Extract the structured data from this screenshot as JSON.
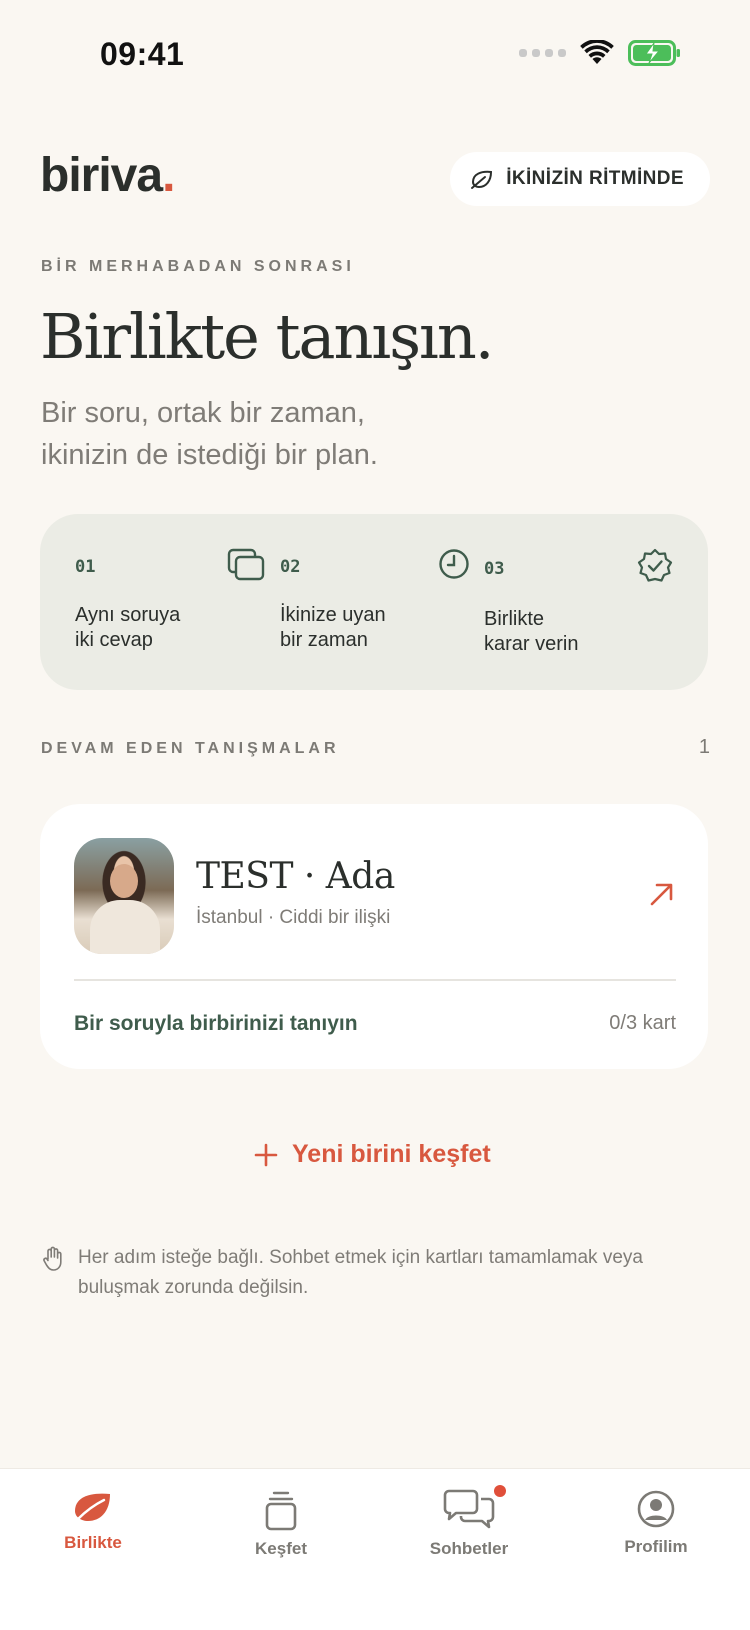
{
  "status_bar": {
    "time": "09:41"
  },
  "header": {
    "logo": "biriva",
    "logo_dot": ".",
    "rhythm_pill": "İKİNİZİN RİTMİNDE"
  },
  "hero": {
    "eyebrow": "BİR MERHABADAN SONRASI",
    "title": "Birlikte tanışın.",
    "subtitle_line1": "Bir soru, ortak bir zaman,",
    "subtitle_line2": "ikinizin de istediği bir plan."
  },
  "steps": [
    {
      "number": "01",
      "line1": "Aynı soruya",
      "line2": "iki cevap",
      "icon": "cards-icon"
    },
    {
      "number": "02",
      "line1": "İkinize uyan",
      "line2": "bir zaman",
      "icon": "clock-icon"
    },
    {
      "number": "03",
      "line1": "Birlikte",
      "line2": "karar verin",
      "icon": "verified-badge-icon"
    }
  ],
  "ongoing": {
    "title": "DEVAM EDEN TANIŞMALAR",
    "count": "1"
  },
  "match": {
    "name": "TEST · Ada",
    "meta": "İstanbul · Ciddi bir ilişki",
    "prompt": "Bir soruyla birbirinizi tanıyın",
    "progress": "0/3 kart"
  },
  "discover": {
    "label": "Yeni birini keşfet"
  },
  "note": {
    "text": "Her adım isteğe bağlı. Sohbet etmek için kartları tamamlamak veya buluşmak zorunda değilsin."
  },
  "tabs": [
    {
      "label": "Birlikte",
      "icon": "leaf-icon",
      "active": true
    },
    {
      "label": "Keşfet",
      "icon": "card-stack-icon",
      "active": false
    },
    {
      "label": "Sohbetler",
      "icon": "chat-bubbles-icon",
      "active": false,
      "badge": true
    },
    {
      "label": "Profilim",
      "icon": "profile-icon",
      "active": false
    }
  ],
  "colors": {
    "background": "#faf7f2",
    "accent": "#d8583f",
    "green": "#3f5c4c",
    "card": "#ffffff",
    "steps_bg": "#ebece5"
  }
}
